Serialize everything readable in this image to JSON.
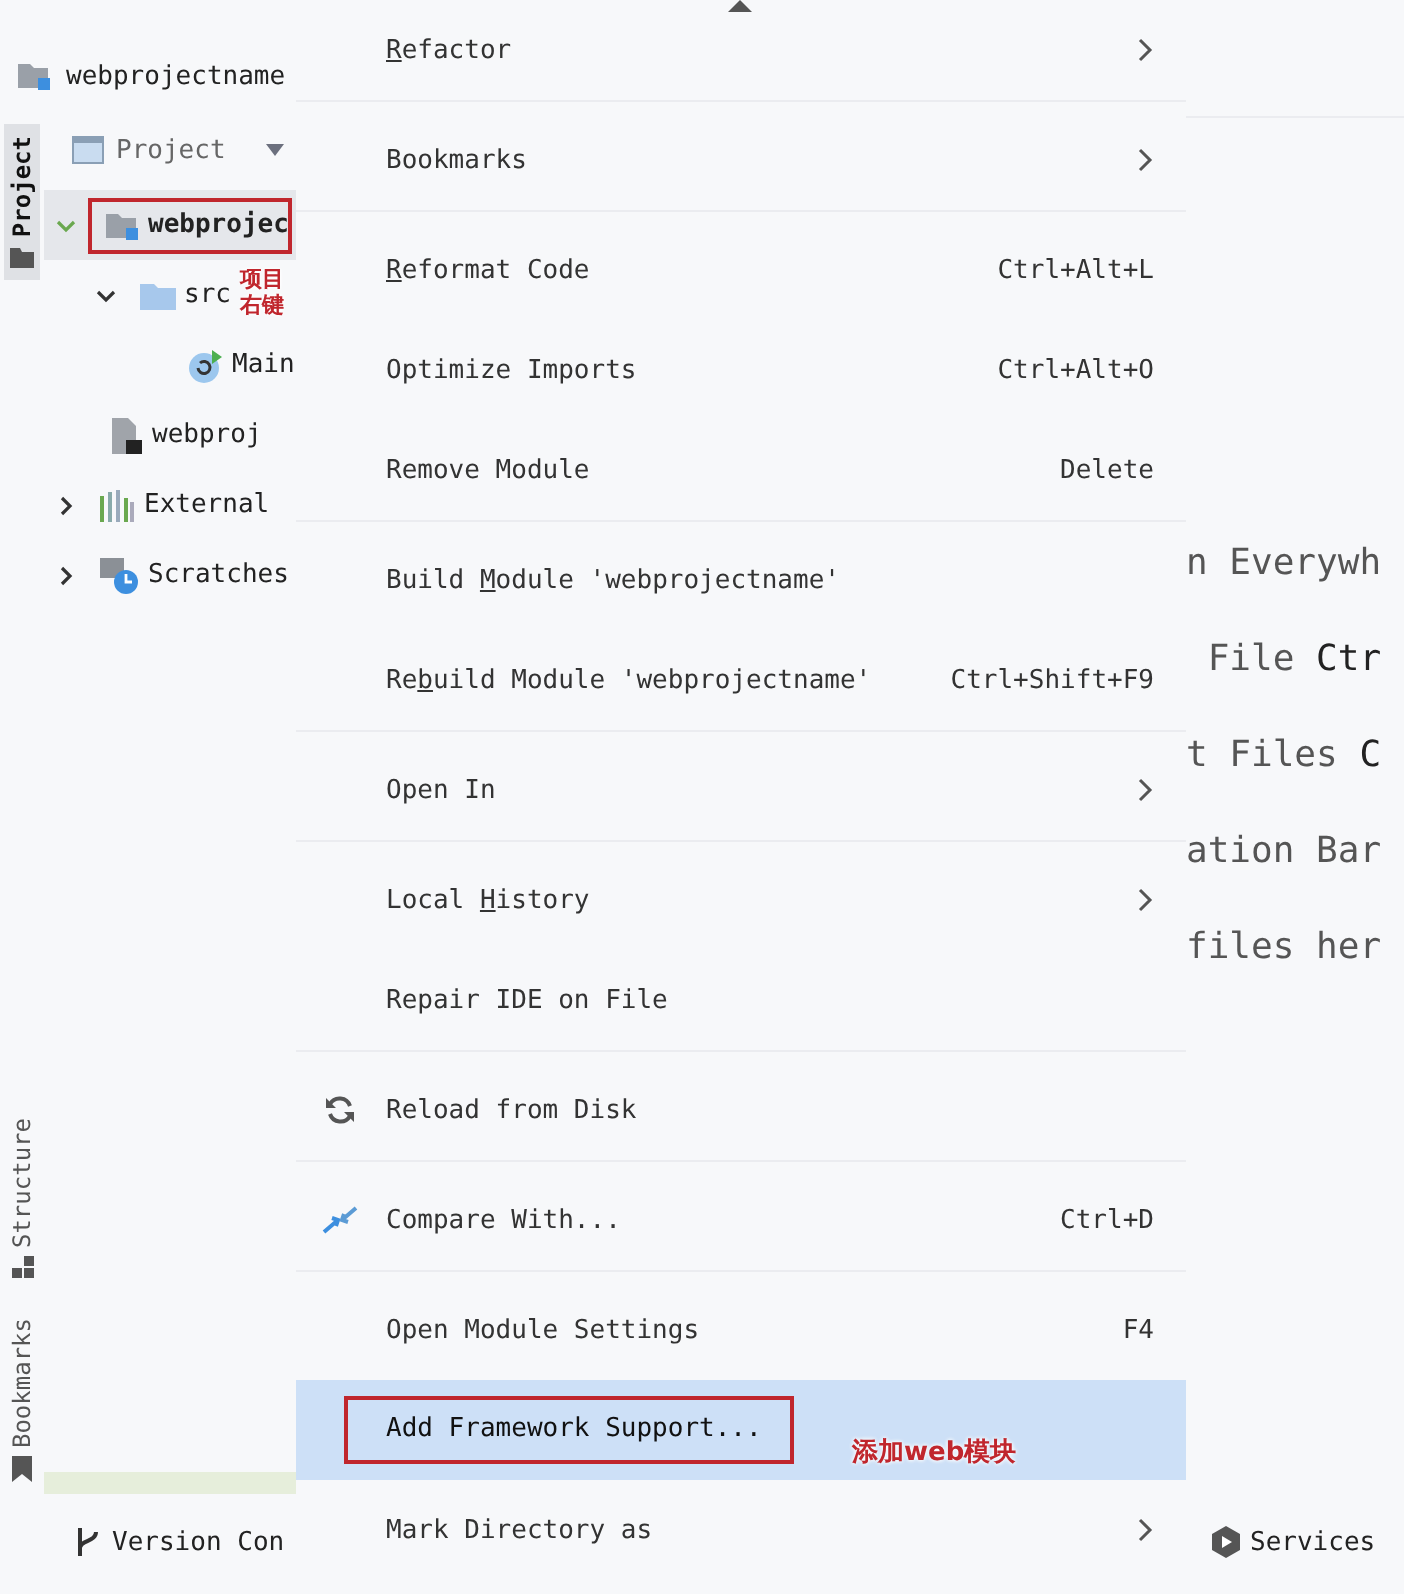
{
  "project_header": {
    "title": "webprojectname"
  },
  "side_tabs": [
    {
      "label": "Project",
      "selected": true,
      "kind": "project"
    },
    {
      "label": "Structure",
      "selected": false,
      "kind": "structure"
    },
    {
      "label": "Bookmarks",
      "selected": false,
      "kind": "bookmarks"
    }
  ],
  "view_selector": {
    "label": "Project"
  },
  "tree": [
    {
      "label": "webprojec",
      "kind": "module",
      "expanded": true,
      "selected": true,
      "boxed": true,
      "note": "项目右键",
      "children": [
        {
          "label": "src",
          "kind": "folder",
          "expanded": true,
          "selected": false,
          "children": [
            {
              "label": "Main",
              "kind": "class",
              "selected": false
            }
          ]
        },
        {
          "label": "webproj",
          "kind": "iml",
          "selected": false
        }
      ]
    },
    {
      "label": "External",
      "kind": "libraries",
      "expanded": false,
      "selected": false
    },
    {
      "label": "Scratches",
      "kind": "scratches",
      "expanded": false,
      "selected": false
    }
  ],
  "bottom_tool": {
    "label": "Version Con"
  },
  "menu": [
    {
      "key": "R",
      "post": "efactor",
      "submenu": true,
      "selected": false,
      "separator_after": true
    },
    {
      "label": "Bookmarks",
      "submenu": true,
      "selected": false,
      "separator_after": true
    },
    {
      "key": "R",
      "post": "eformat Code",
      "shortcut": "Ctrl+Alt+L",
      "selected": false
    },
    {
      "label": "Optimize Imports",
      "shortcut": "Ctrl+Alt+O",
      "selected": false
    },
    {
      "label": "Remove Module",
      "shortcut": "Delete",
      "selected": false,
      "separator_after": true
    },
    {
      "pre": "Build ",
      "key": "M",
      "post": "odule 'webprojectname'",
      "selected": false
    },
    {
      "pre": "Re",
      "key": "b",
      "post": "uild Module 'webprojectname'",
      "shortcut": "Ctrl+Shift+F9",
      "selected": false,
      "separator_after": true
    },
    {
      "label": "Open In",
      "submenu": true,
      "selected": false,
      "separator_after": true
    },
    {
      "pre": "Local ",
      "key": "H",
      "post": "istory",
      "submenu": true,
      "selected": false
    },
    {
      "label": "Repair IDE on File",
      "selected": false,
      "separator_after": true
    },
    {
      "label": "Reload from Disk",
      "kind": "reload",
      "selected": false,
      "separator_after": true
    },
    {
      "label": "Compare With...",
      "kind": "compare",
      "shortcut": "Ctrl+D",
      "selected": false,
      "separator_after": true
    },
    {
      "label": "Open Module Settings",
      "shortcut": "F4",
      "selected": false
    },
    {
      "label": "Add Framework Support...",
      "selected": true,
      "boxed": true,
      "note": "添加web模块"
    },
    {
      "label": "Mark Directory as",
      "submenu": true,
      "selected": false
    }
  ],
  "editor_hints": [
    {
      "text": "n Everywh"
    },
    {
      "text": " File ",
      "key": "Ctr"
    },
    {
      "text": "t Files ",
      "key": "C"
    },
    {
      "text": "ation Bar"
    },
    {
      "text": "files her"
    }
  ],
  "services": {
    "label": "Services"
  }
}
